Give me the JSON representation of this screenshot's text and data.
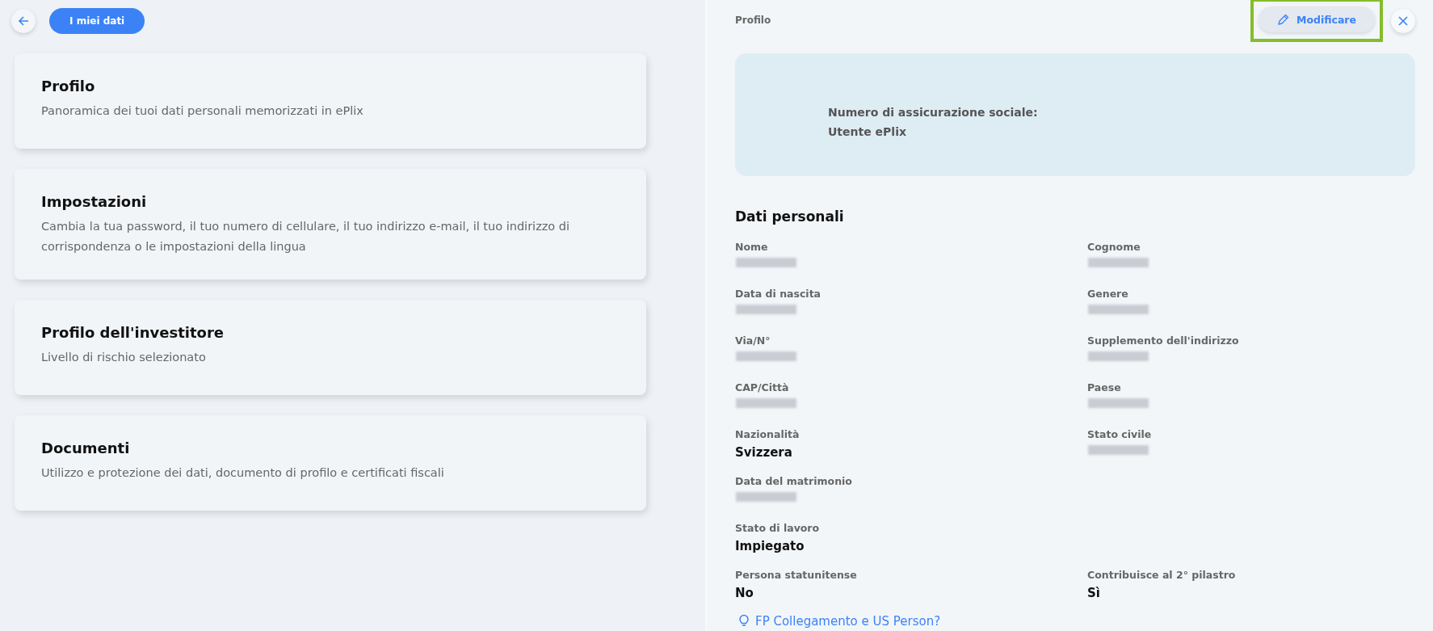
{
  "header": {
    "title_button": {
      "label": "I miei dati"
    }
  },
  "menu_cards": [
    {
      "title": "Profilo",
      "description": "Panoramica dei tuoi dati personali memorizzati in ePlix"
    },
    {
      "title": "Impostazioni",
      "description": "Cambia la tua password, il tuo numero di cellulare, il tuo indirizzo e-mail, il tuo indirizzo di corrispondenza o le impostazioni della lingua"
    },
    {
      "title": "Profilo dell'investitore",
      "description": "Livello di rischio selezionato"
    },
    {
      "title": "Documenti",
      "description": "Utilizzo e protezione dei dati, documento di profilo e certificati fiscali"
    }
  ],
  "detail": {
    "title": "Profilo",
    "edit_button": {
      "label": "Modificare",
      "highlighted": true
    },
    "summary": [
      "Numero di assicurazione sociale:",
      "Utente ePlix"
    ],
    "section_title": "Dati personali",
    "fields": [
      {
        "label": "Nome",
        "kind": "redacted"
      },
      {
        "label": "Cognome",
        "kind": "redacted"
      },
      {
        "label": "Data di nascita",
        "kind": "redacted"
      },
      {
        "label": "Genere",
        "kind": "redacted"
      },
      {
        "label": "Via/N°",
        "kind": "redacted"
      },
      {
        "label": "Supplemento dell'indirizzo",
        "kind": "redacted"
      },
      {
        "label": "CAP/Città",
        "kind": "redacted"
      },
      {
        "label": "Paese",
        "kind": "redacted"
      },
      {
        "label": "Nazionalità",
        "kind": "text",
        "value": "Svizzera"
      },
      {
        "label": "Stato civile",
        "kind": "redacted"
      },
      {
        "label": "Data del matrimonio",
        "kind": "redacted"
      },
      {
        "kind": "empty"
      },
      {
        "label": "Stato di lavoro",
        "kind": "text",
        "value": "Impiegato"
      },
      {
        "kind": "empty"
      },
      {
        "label": "Persona statunitense",
        "kind": "text",
        "value": "No"
      },
      {
        "label": "Contribuisce al 2° pilastro",
        "kind": "text",
        "value": "Sì"
      }
    ],
    "help_link": "FP Collegamento e US Person?"
  }
}
